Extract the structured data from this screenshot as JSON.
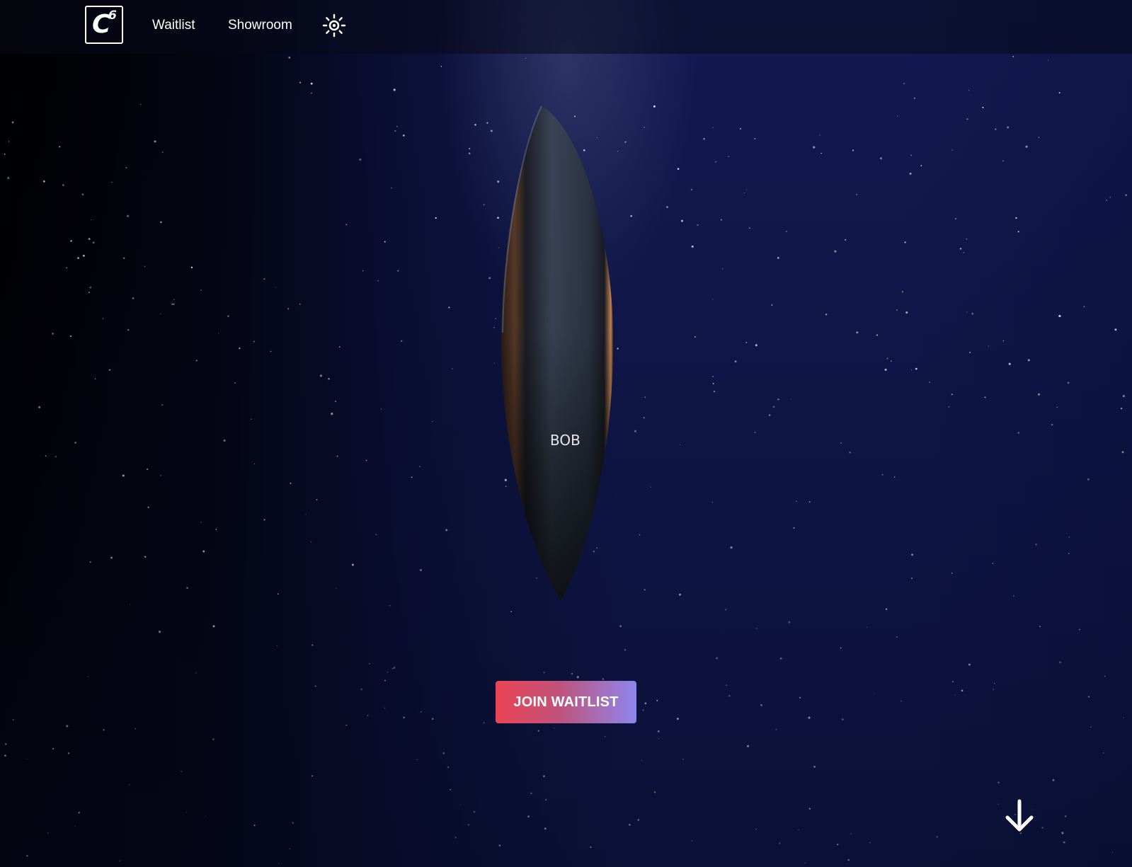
{
  "header": {
    "logo": {
      "letter": "C",
      "superscript": "6"
    },
    "nav": {
      "waitlist_label": "Waitlist",
      "showroom_label": "Showroom"
    },
    "theme_icon": "sun-icon"
  },
  "hero": {
    "board_text": "BOB",
    "cta_label": "JOIN WAITLIST",
    "scroll_icon": "arrow-down-icon"
  },
  "colors": {
    "background": "#121a52",
    "cta_gradient_start": "#ec4453",
    "cta_gradient_end": "#8e85ef",
    "text": "#ffffff"
  }
}
